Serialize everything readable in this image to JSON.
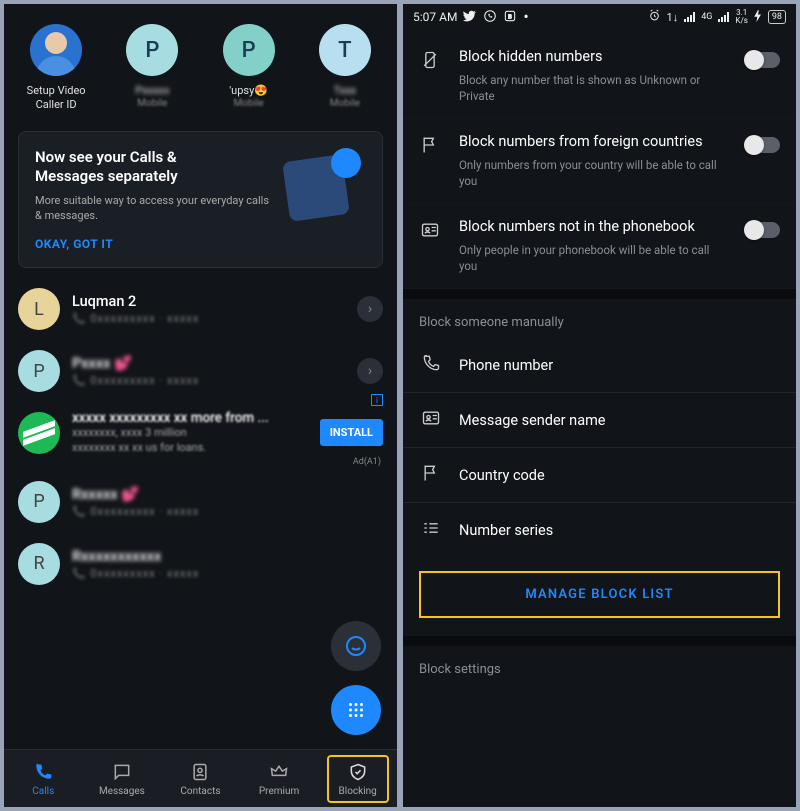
{
  "left": {
    "favorites": [
      {
        "label": "Setup Video\nCaller ID",
        "sub": "",
        "initial": "",
        "color": "avatar"
      },
      {
        "label": "Pxxxxx",
        "sub": "Mobile",
        "initial": "P",
        "color": "#a7dde0"
      },
      {
        "label": "'upsy😍",
        "sub": "Mobile",
        "initial": "P",
        "color": "#83d0c9"
      },
      {
        "label": "Txxx",
        "sub": "Mobile",
        "initial": "T",
        "color": "#b8dff0"
      }
    ],
    "banner": {
      "title_line1": "Now see your Calls &",
      "title_line2": "Messages separately",
      "desc": "More suitable way to access your everyday calls & messages.",
      "action": "OKAY, GOT IT"
    },
    "calls": [
      {
        "initial": "L",
        "color": "#e8d49a",
        "name": "Luqman 2",
        "meta": "📞 0xxxxxxxxx · xxxxx"
      },
      {
        "initial": "P",
        "color": "#a7dde0",
        "name": "Pxxxx 💕",
        "meta": "📞 0xxxxxxxxx · xxxxx"
      }
    ],
    "ad": {
      "title_clear": "more from ...",
      "sub_clear_mid": "3 million",
      "sub_clear_end": "us for loans.",
      "install": "INSTALL",
      "meta": "Ad(A1)"
    },
    "more_calls": [
      {
        "initial": "P",
        "color": "#a7dde0",
        "name": "Rxxxxx 💕",
        "meta": "📞 0xxxxxxxxx · xxxxx"
      },
      {
        "initial": "R",
        "color": "#a7dde0",
        "name": "Rxxxxxxxxxxx",
        "meta": "📞 0xxxxxxxxx · xxxxx"
      }
    ],
    "nav": {
      "calls": "Calls",
      "messages": "Messages",
      "contacts": "Contacts",
      "premium": "Premium",
      "blocking": "Blocking"
    }
  },
  "right": {
    "status": {
      "time": "5:07 AM",
      "net_speed": "3.1\nK/s",
      "battery": "98",
      "sig_label": "4G"
    },
    "toggles": [
      {
        "title": "Block hidden numbers",
        "desc": "Block any number that is shown as Unknown or Private"
      },
      {
        "title": "Block numbers from foreign countries",
        "desc": "Only numbers from your country will be able to call you"
      },
      {
        "title": "Block numbers not in the phonebook",
        "desc": "Only people in your phonebook will be able to call you"
      }
    ],
    "manual_header": "Block someone manually",
    "manual_options": {
      "phone": "Phone number",
      "sender": "Message sender name",
      "country": "Country code",
      "series": "Number series"
    },
    "manage_btn": "MANAGE BLOCK LIST",
    "settings_header": "Block settings"
  }
}
